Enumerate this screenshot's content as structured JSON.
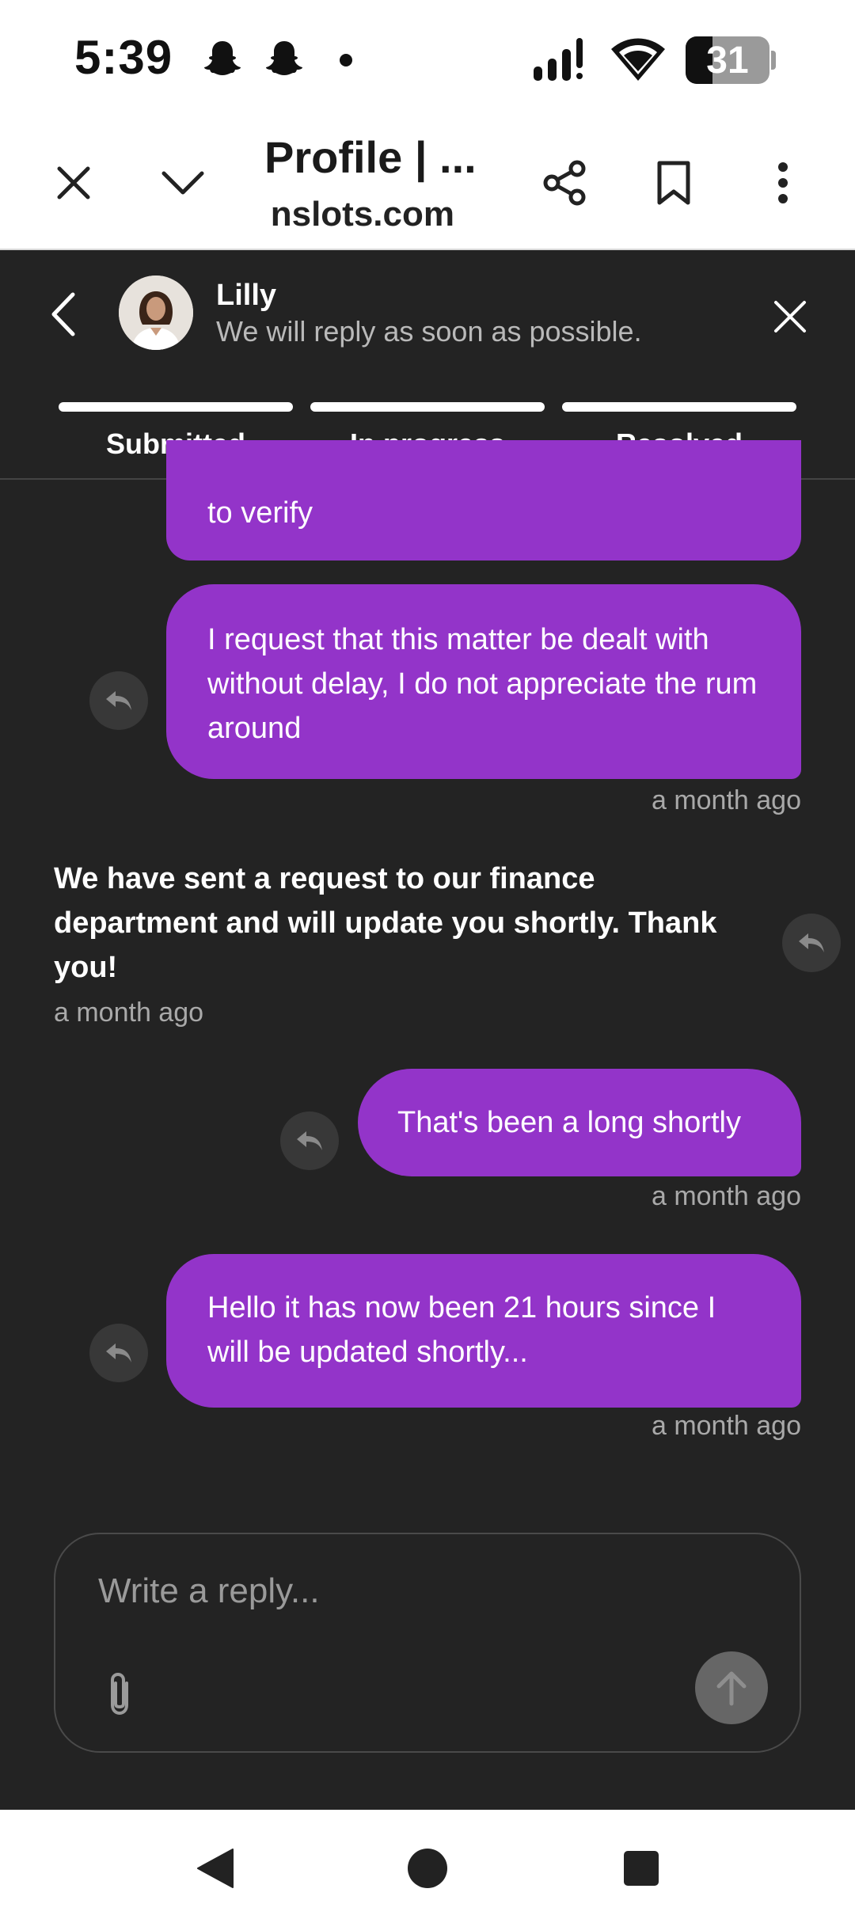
{
  "status_bar": {
    "time": "5:39",
    "battery": "31"
  },
  "browser": {
    "title": "Profile | ...",
    "url": "nslots.com"
  },
  "chat": {
    "agent_name": "Lilly",
    "agent_subtitle": "We will reply as soon as possible.",
    "steps": [
      "Submitted",
      "In progress",
      "Resolved"
    ],
    "messages": [
      {
        "text": "to verify",
        "from": "user"
      },
      {
        "text": "I request that this matter be dealt with without delay, I do not appreciate the rum around",
        "from": "user",
        "time": "a month ago"
      },
      {
        "text": "We have sent a request to our finance department and will update you shortly. Thank you!",
        "from": "agent",
        "time": "a month ago"
      },
      {
        "text": "That's been a long shortly",
        "from": "user",
        "time": "a month ago"
      },
      {
        "text": "Hello it has now been 21 hours since I will be updated shortly...",
        "from": "user",
        "time": "a month ago"
      }
    ],
    "composer": {
      "placeholder": "Write a reply..."
    }
  },
  "colors": {
    "bubble": "#9334c9",
    "chat_bg": "#232323"
  },
  "icons": [
    "snapchat-icon",
    "signal-icon",
    "wifi-icon",
    "battery-icon",
    "close-icon",
    "chevron-down-icon",
    "share-icon",
    "bookmark-icon",
    "more-vert-icon",
    "back-chevron-icon",
    "reply-icon",
    "paperclip-icon",
    "send-arrow-icon",
    "nav-back-icon",
    "nav-home-icon",
    "nav-recents-icon"
  ]
}
